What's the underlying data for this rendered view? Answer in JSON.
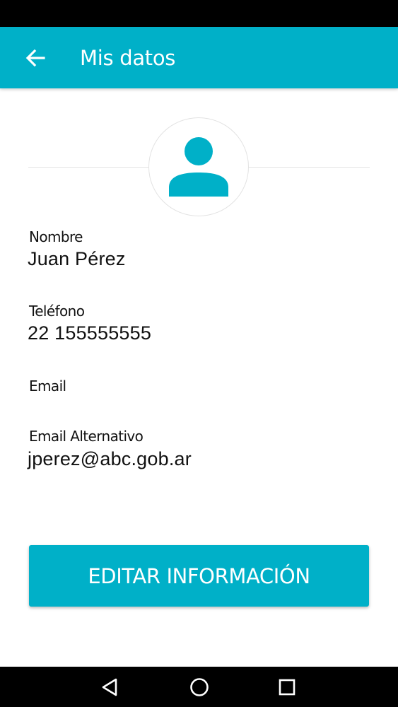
{
  "app_bar": {
    "title": "Mis datos",
    "back_icon": "arrow-left-icon"
  },
  "profile": {
    "avatar_icon": "person-icon"
  },
  "fields": {
    "nombre": {
      "label": "Nombre",
      "value": "Juan Pérez"
    },
    "telefono": {
      "label": "Teléfono",
      "value": "22 155555555"
    },
    "email": {
      "label": "Email",
      "value": ""
    },
    "email_alternativo": {
      "label": "Email Alternativo",
      "value": "jperez@abc.gob.ar"
    }
  },
  "actions": {
    "edit_label": "EDITAR INFORMACIÓN"
  },
  "nav_bar": {
    "icons": [
      "back-triangle-icon",
      "home-circle-icon",
      "recents-square-icon"
    ]
  },
  "colors": {
    "accent": "#00b0c8",
    "text": "#111111",
    "background": "#ffffff",
    "system_bars": "#000000"
  }
}
